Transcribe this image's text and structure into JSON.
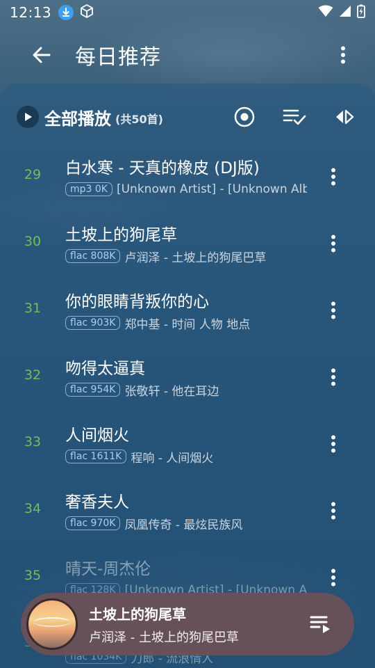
{
  "status_bar": {
    "time": "12:13"
  },
  "header": {
    "title": "每日推荐"
  },
  "toolbar": {
    "play_all_label": "全部播放",
    "count_label": "(共50首)"
  },
  "songs": [
    {
      "index": "29",
      "title": "白水寒 - 天真的橡皮 (DJ版)",
      "quality": "mp3 0K",
      "artist": "[Unknown Artist] - [Unknown Album]"
    },
    {
      "index": "30",
      "title": "土坡上的狗尾草",
      "quality": "flac 808K",
      "artist": "卢润泽 - 土坡上的狗尾巴草"
    },
    {
      "index": "31",
      "title": "你的眼睛背叛你的心",
      "quality": "flac 903K",
      "artist": "郑中基 - 时间 人物 地点"
    },
    {
      "index": "32",
      "title": "吻得太逼真",
      "quality": "flac 954K",
      "artist": "张敬轩 - 他在耳边"
    },
    {
      "index": "33",
      "title": "人间烟火",
      "quality": "flac 1611K",
      "artist": "程响 - 人间烟火"
    },
    {
      "index": "34",
      "title": "奢香夫人",
      "quality": "flac 970K",
      "artist": "凤凰传奇 - 最炫民族风"
    },
    {
      "index": "35",
      "title": "晴天-周杰伦",
      "quality": "flac 128K",
      "artist": "[Unknown Artist] - [Unknown Album]"
    },
    {
      "index": "36",
      "title": "",
      "quality": "flac 1034K",
      "artist": "刀郎 - 流浪情人"
    }
  ],
  "mini_player": {
    "title": "土坡上的狗尾草",
    "artist": "卢润泽 - 土坡上的狗尾巴草"
  },
  "colors": {
    "index_green": "#6cc05a",
    "mini_player_bg": "#695058",
    "download_badge": "#3ea0f0"
  },
  "icons": {
    "back": "arrow-left-icon",
    "more": "more-vert-icon",
    "play_all": "play-circle-icon",
    "record": "target-icon",
    "select": "playlist-check-icon",
    "sort": "arrows-horizontal-icon",
    "playlist": "queue-music-icon"
  }
}
